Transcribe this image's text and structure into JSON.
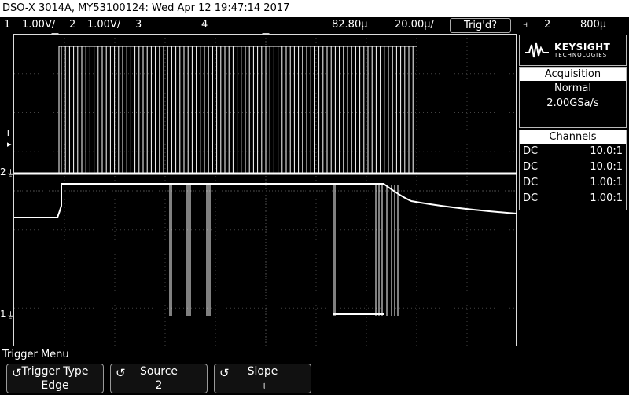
{
  "title_bar": {
    "text": "DSO-X 3014A, MY53100124: Wed Apr 12 19:47:14 2017"
  },
  "status": {
    "ch1": "1",
    "ch1_scale": "1.00V/",
    "ch2": "2",
    "ch2_scale": "1.00V/",
    "ch3": "3",
    "ch4": "4",
    "time_position": "82.80µ",
    "time_scale": "20.00µ/",
    "trigger_state": "Trig'd?",
    "trigger_slope_icon": "falling-edge-icon",
    "trigger_source": "2",
    "trigger_level": "800µ"
  },
  "logo": {
    "brand": "KEYSIGHT",
    "sub": "TECHNOLOGIES"
  },
  "acquisition": {
    "header": "Acquisition",
    "mode": "Normal",
    "rate": "2.00GSa/s"
  },
  "channels": {
    "header": "Channels",
    "rows": [
      {
        "coupling": "DC",
        "probe": "10.0:1"
      },
      {
        "coupling": "DC",
        "probe": "10.0:1"
      },
      {
        "coupling": "DC",
        "probe": "1.00:1"
      },
      {
        "coupling": "DC",
        "probe": "1.00:1"
      }
    ]
  },
  "markers": {
    "trigger": "T",
    "ch2": "2",
    "ch1": "1"
  },
  "menu": {
    "title": "Trigger Menu",
    "softkeys": [
      {
        "label": "Trigger Type",
        "value": "Edge"
      },
      {
        "label": "Source",
        "value": "2"
      },
      {
        "label": "Slope",
        "value": "⫣"
      }
    ]
  }
}
